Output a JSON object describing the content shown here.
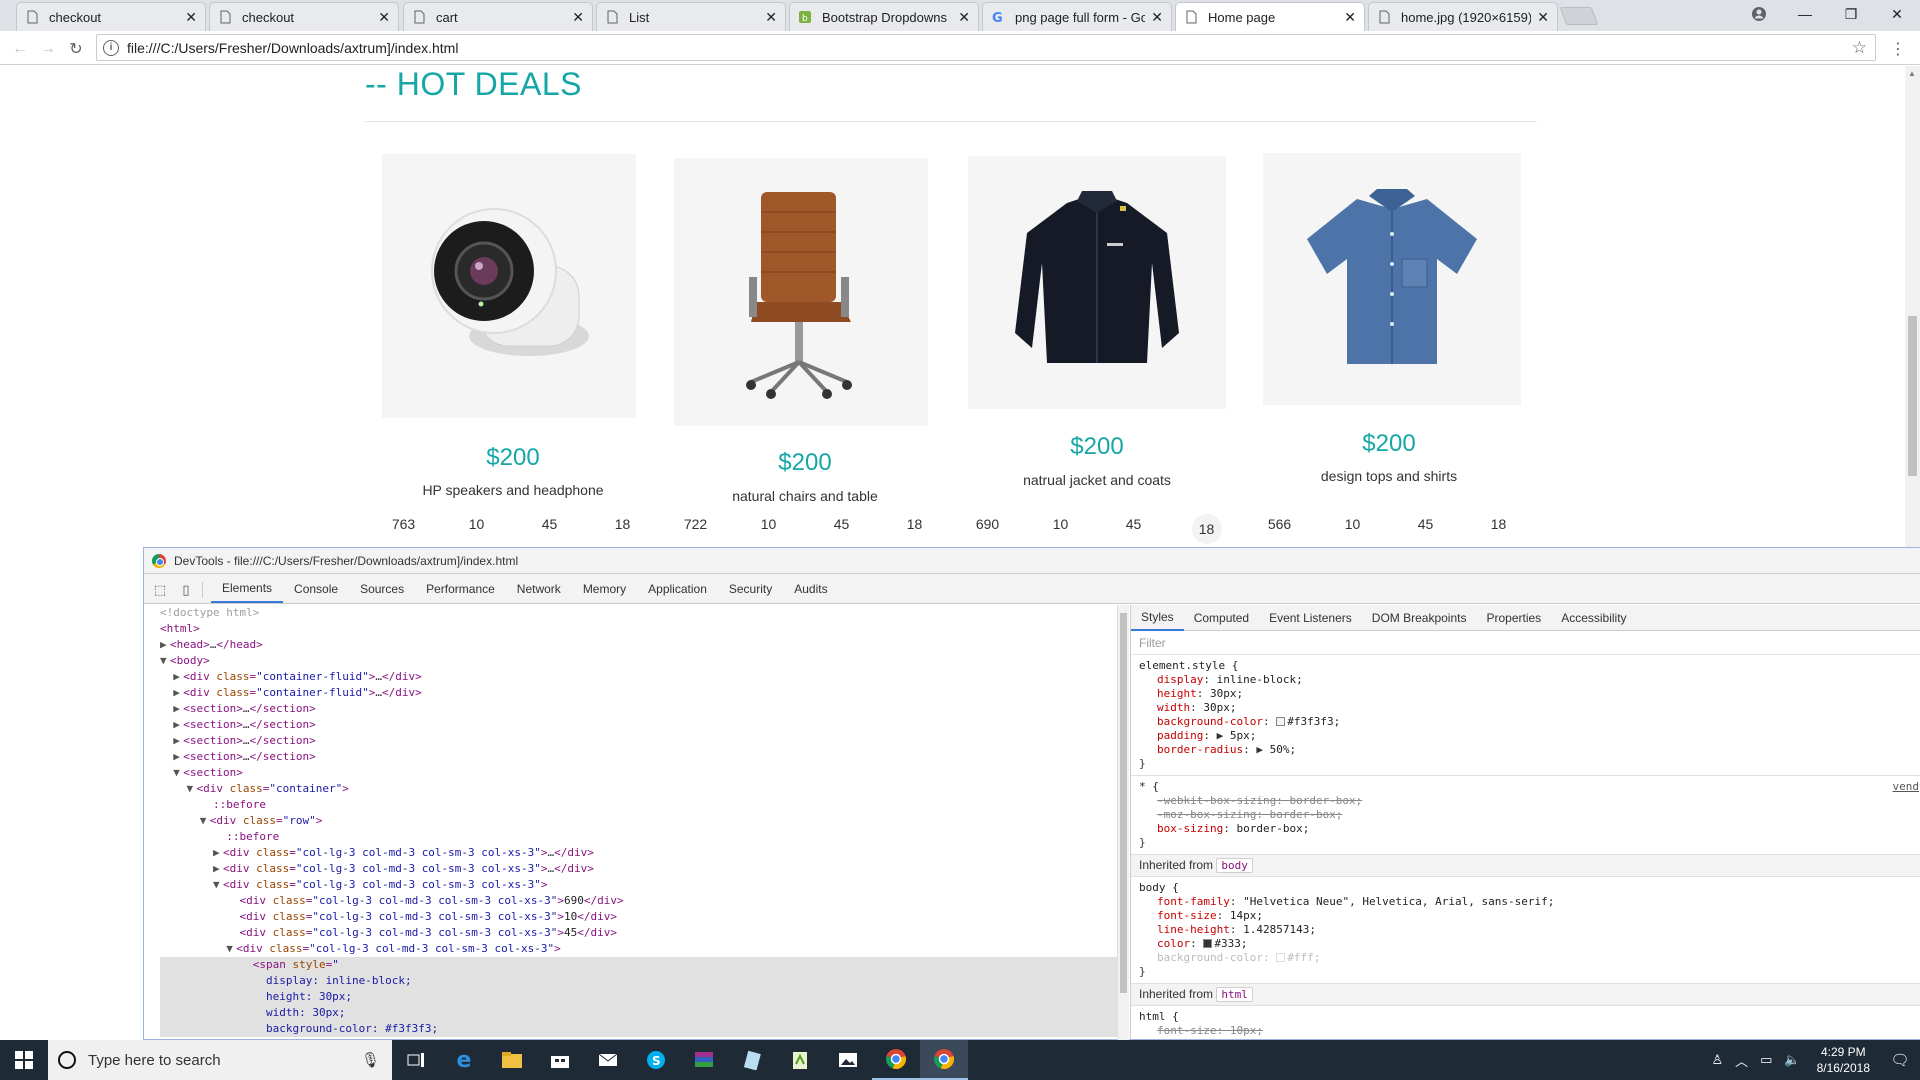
{
  "browser": {
    "tabs": [
      {
        "title": "checkout",
        "icon": "page-icon"
      },
      {
        "title": "checkout",
        "icon": "page-icon"
      },
      {
        "title": "cart",
        "icon": "page-icon"
      },
      {
        "title": "List",
        "icon": "page-icon"
      },
      {
        "title": "Bootstrap Dropdowns",
        "icon": "bootstrap-icon"
      },
      {
        "title": "png page full form - Goo",
        "icon": "google-icon"
      },
      {
        "title": "Home page",
        "icon": "page-icon",
        "active": true
      },
      {
        "title": "home.jpg (1920×6159)",
        "icon": "page-icon"
      }
    ],
    "url": "file:///C:/Users/Fresher/Downloads/axtrum]/index.html"
  },
  "page": {
    "section_title": "-- HOT DEALS",
    "accent_color": "#16a6a6",
    "products": [
      {
        "price": "$200",
        "name": "HP speakers and headphone",
        "stats": [
          "763",
          "10",
          "45",
          "18"
        ],
        "image": "camera"
      },
      {
        "price": "$200",
        "name": "natural chairs and table",
        "stats": [
          "722",
          "10",
          "45",
          "18"
        ],
        "image": "chair"
      },
      {
        "price": "$200",
        "name": "natrual jacket and coats",
        "stats": [
          "690",
          "10",
          "45",
          "18"
        ],
        "image": "jacket",
        "highlight_last": true
      },
      {
        "price": "$200",
        "name": "design tops and shirts",
        "stats": [
          "566",
          "10",
          "45",
          "18"
        ],
        "image": "shirt"
      }
    ]
  },
  "devtools": {
    "title": "DevTools - file:///C:/Users/Fresher/Downloads/axtrum]/index.html",
    "tabs": [
      "Elements",
      "Console",
      "Sources",
      "Performance",
      "Network",
      "Memory",
      "Application",
      "Security",
      "Audits"
    ],
    "style_tabs": [
      "Styles",
      "Computed",
      "Event Listeners",
      "DOM Breakpoints",
      "Properties",
      "Accessibility"
    ],
    "filter_placeholder": "Filter",
    "inherited_label": "Inherited from",
    "vendor_link": "vend"
  },
  "taskbar": {
    "search_placeholder": "Type here to search",
    "time": "4:29 PM",
    "date": "8/16/2018"
  }
}
